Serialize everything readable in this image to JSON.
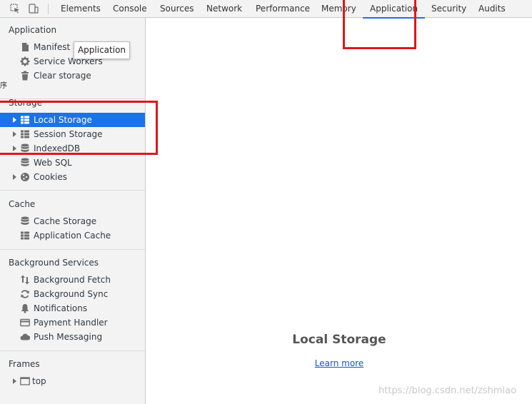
{
  "toolbar": {
    "tabs": [
      {
        "label": "Elements"
      },
      {
        "label": "Console"
      },
      {
        "label": "Sources"
      },
      {
        "label": "Network"
      },
      {
        "label": "Performance"
      },
      {
        "label": "Memory"
      },
      {
        "label": "Application"
      },
      {
        "label": "Security"
      },
      {
        "label": "Audits"
      }
    ],
    "active_tab": "Application"
  },
  "sidebar": {
    "application": {
      "title": "Application",
      "items": [
        {
          "label": "Manifest",
          "icon": "document-icon"
        },
        {
          "label": "Service Workers",
          "icon": "gear-icon"
        },
        {
          "label": "Clear storage",
          "icon": "trash-icon"
        }
      ]
    },
    "storage": {
      "title": "Storage",
      "items": [
        {
          "label": "Local Storage",
          "icon": "table-icon",
          "selected": true
        },
        {
          "label": "Session Storage",
          "icon": "table-icon"
        },
        {
          "label": "IndexedDB",
          "icon": "database-icon"
        },
        {
          "label": "Web SQL",
          "icon": "database-icon"
        },
        {
          "label": "Cookies",
          "icon": "cookie-icon"
        }
      ]
    },
    "cache": {
      "title": "Cache",
      "items": [
        {
          "label": "Cache Storage",
          "icon": "database-icon"
        },
        {
          "label": "Application Cache",
          "icon": "table-icon"
        }
      ]
    },
    "background_services": {
      "title": "Background Services",
      "items": [
        {
          "label": "Background Fetch",
          "icon": "up-down-arrows-icon"
        },
        {
          "label": "Background Sync",
          "icon": "sync-icon"
        },
        {
          "label": "Notifications",
          "icon": "bell-icon"
        },
        {
          "label": "Payment Handler",
          "icon": "card-icon"
        },
        {
          "label": "Push Messaging",
          "icon": "cloud-icon"
        }
      ]
    },
    "frames": {
      "title": "Frames",
      "items": [
        {
          "label": "top",
          "icon": "frame-icon"
        }
      ]
    }
  },
  "tooltip": {
    "text": "Application"
  },
  "main": {
    "title": "Local Storage",
    "link": "Learn more"
  },
  "left_stub": "序",
  "watermark": "https://blog.csdn.net/zshmiao",
  "colors": {
    "accent": "#1a73e8",
    "annotation": "#e0161a",
    "link": "#1155cc"
  }
}
